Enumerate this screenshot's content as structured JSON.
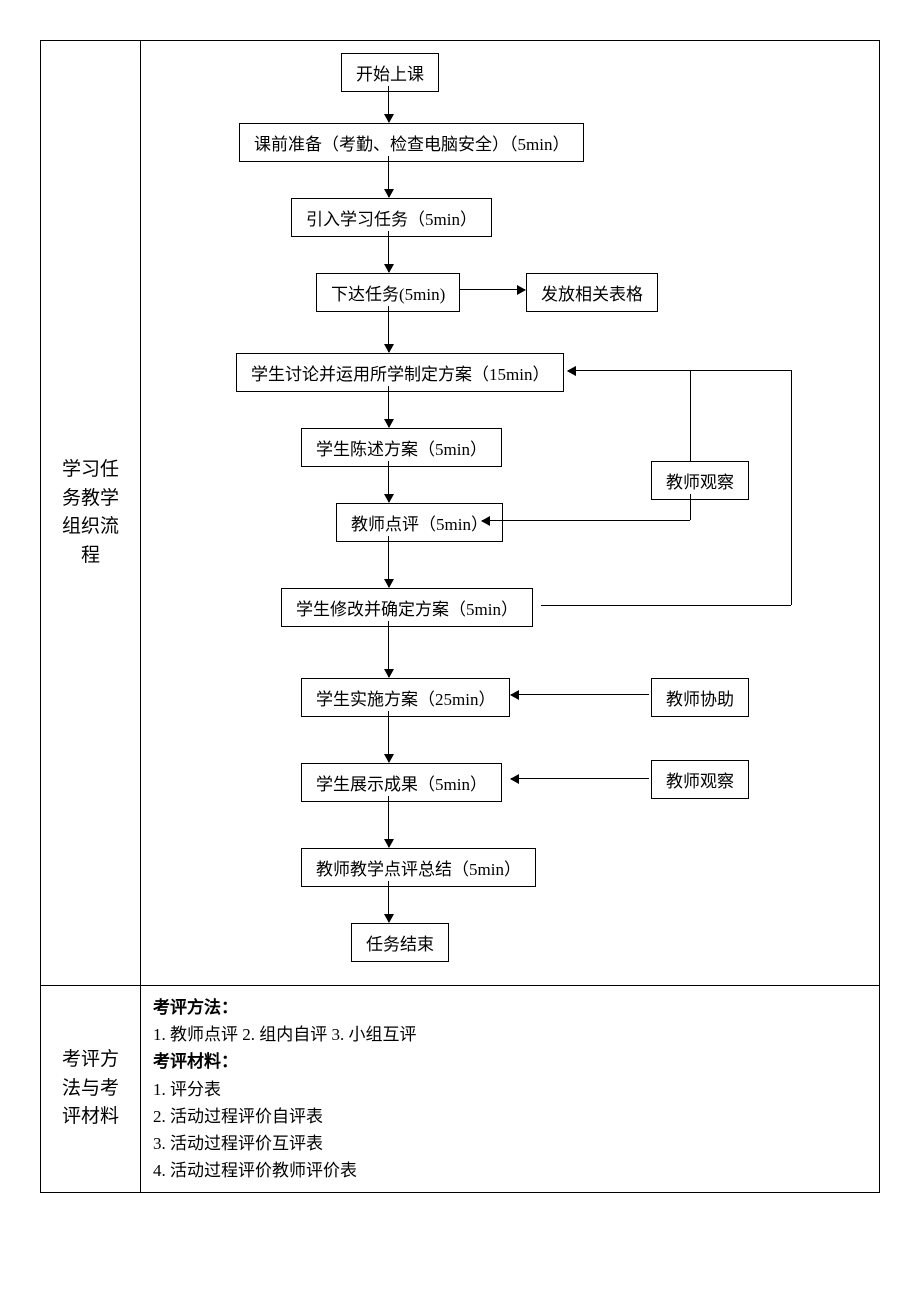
{
  "row1": {
    "label": "学习任务教学组织流程",
    "nodes": {
      "start": "开始上课",
      "prep": "课前准备（考勤、检查电脑安全）（5min）",
      "intro": "引入学习任务（5min）",
      "assign": "下达任务(5min)",
      "forms": "发放相关表格",
      "discuss": "学生讨论并运用所学制定方案（15min）",
      "present": "学生陈述方案（5min）",
      "observe1": "教师观察",
      "review": "教师点评（5min）",
      "revise": "学生修改并确定方案（5min）",
      "implement": "学生实施方案（25min）",
      "assist": "教师协助",
      "show": "学生展示成果（5min）",
      "observe2": "教师观察",
      "summary": "教师教学点评总结（5min）",
      "end": "任务结束"
    }
  },
  "row2": {
    "label": "考评方法与考评材料",
    "method_title": "考评方法：",
    "methods": "1. 教师点评    2. 组内自评    3. 小组互评",
    "material_title": "考评材料：",
    "m1": "1. 评分表",
    "m2": "2. 活动过程评价自评表",
    "m3": "3. 活动过程评价互评表",
    "m4": "4. 活动过程评价教师评价表"
  },
  "chart_data": {
    "type": "flowchart",
    "title": "学习任务教学组织流程",
    "nodes": [
      {
        "id": "start",
        "label": "开始上课"
      },
      {
        "id": "prep",
        "label": "课前准备（考勤、检查电脑安全）（5min）"
      },
      {
        "id": "intro",
        "label": "引入学习任务（5min）"
      },
      {
        "id": "assign",
        "label": "下达任务(5min)"
      },
      {
        "id": "forms",
        "label": "发放相关表格"
      },
      {
        "id": "discuss",
        "label": "学生讨论并运用所学制定方案（15min）"
      },
      {
        "id": "present",
        "label": "学生陈述方案（5min）"
      },
      {
        "id": "observe1",
        "label": "教师观察"
      },
      {
        "id": "review",
        "label": "教师点评（5min）"
      },
      {
        "id": "revise",
        "label": "学生修改并确定方案（5min）"
      },
      {
        "id": "implement",
        "label": "学生实施方案（25min）"
      },
      {
        "id": "assist",
        "label": "教师协助"
      },
      {
        "id": "show",
        "label": "学生展示成果（5min）"
      },
      {
        "id": "observe2",
        "label": "教师观察"
      },
      {
        "id": "summary",
        "label": "教师教学点评总结（5min）"
      },
      {
        "id": "end",
        "label": "任务结束"
      }
    ],
    "edges": [
      {
        "from": "start",
        "to": "prep"
      },
      {
        "from": "prep",
        "to": "intro"
      },
      {
        "from": "intro",
        "to": "assign"
      },
      {
        "from": "assign",
        "to": "forms"
      },
      {
        "from": "assign",
        "to": "discuss"
      },
      {
        "from": "discuss",
        "to": "present"
      },
      {
        "from": "present",
        "to": "review"
      },
      {
        "from": "review",
        "to": "revise"
      },
      {
        "from": "revise",
        "to": "implement"
      },
      {
        "from": "implement",
        "to": "show"
      },
      {
        "from": "show",
        "to": "summary"
      },
      {
        "from": "summary",
        "to": "end"
      },
      {
        "from": "observe1",
        "to": "discuss"
      },
      {
        "from": "observe1",
        "to": "review"
      },
      {
        "from": "revise",
        "to": "discuss",
        "note": "feedback loop"
      },
      {
        "from": "assist",
        "to": "implement"
      },
      {
        "from": "observe2",
        "to": "show"
      }
    ]
  }
}
